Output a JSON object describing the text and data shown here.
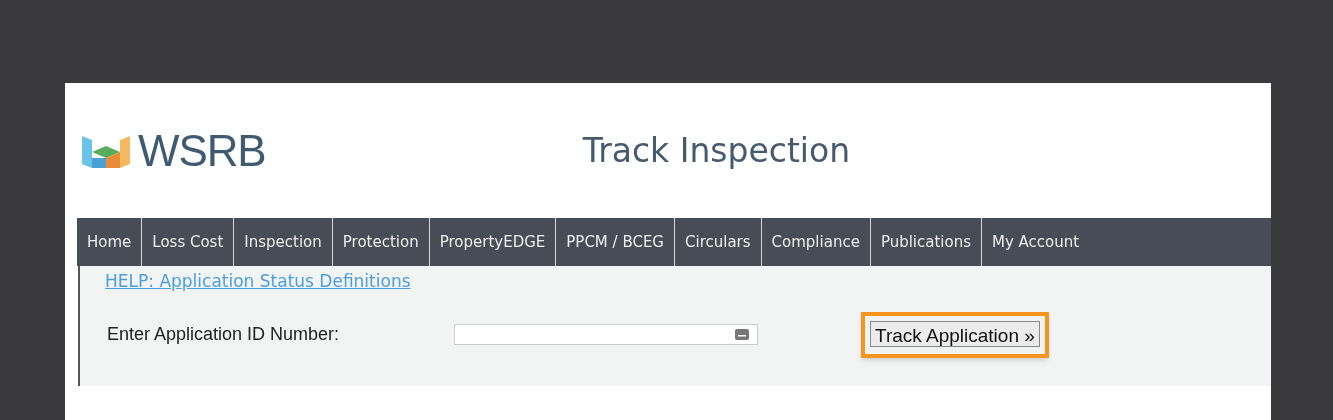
{
  "header": {
    "logo": "WSRB",
    "title": "Track Inspection"
  },
  "nav": [
    {
      "label": "Home"
    },
    {
      "label": "Loss Cost"
    },
    {
      "label": "Inspection"
    },
    {
      "label": "Protection"
    },
    {
      "label": "PropertyEDGE"
    },
    {
      "label": "PPCM / BCEG"
    },
    {
      "label": "Circulars"
    },
    {
      "label": "Compliance"
    },
    {
      "label": "Publications"
    },
    {
      "label": "My Account"
    }
  ],
  "help_link": "HELP: Application Status Definitions",
  "form": {
    "label": "Enter Application ID Number:",
    "button": "Track Application »",
    "button_highlighted": true
  }
}
